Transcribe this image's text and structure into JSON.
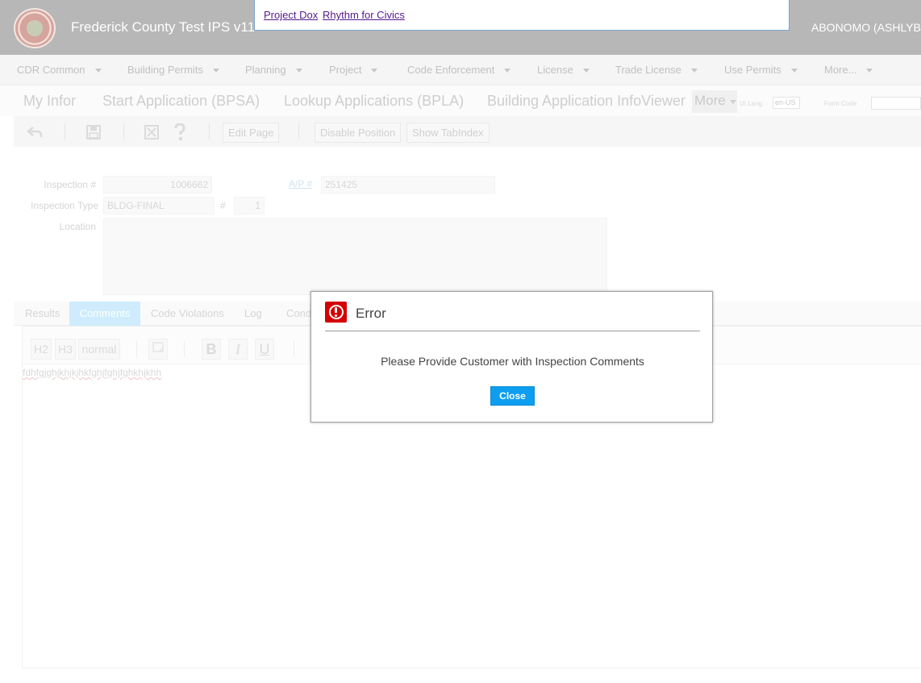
{
  "header": {
    "app_title": "Frederick County Test IPS v11",
    "user": "ABONOMO (ASHLYB"
  },
  "popup_links": {
    "project_dox": "Project Dox",
    "rhythm": "Rhythm for Civics"
  },
  "nav": {
    "items": [
      "CDR Common",
      "Building Permits",
      "Planning",
      "Project",
      "Code Enforcement",
      "License",
      "Trade License",
      "Use Permits",
      "More..."
    ]
  },
  "top_tabs": {
    "items": [
      "My Infor",
      "Start Application (BPSA)",
      "Lookup Applications (BPLA)",
      "Building Application InfoViewer"
    ],
    "more": "More",
    "ui_lang_label": "UI Lang",
    "ui_lang_value": "en-US",
    "form_code_label": "Form Code"
  },
  "toolbar": {
    "edit_page": "Edit Page",
    "disable_position": "Disable Position",
    "show_tabindex": "Show TabIndex"
  },
  "form": {
    "inspection_label": "Inspection #",
    "inspection_value": "1006662",
    "ap_label": "A/P #",
    "ap_value": "251425",
    "type_label": "Inspection Type",
    "type_value": "BLDG-FINAL",
    "hash_label": "#",
    "hash_value": "1",
    "location_label": "Location"
  },
  "sub_tabs": {
    "items": [
      "Results",
      "Comments",
      "Code Violations",
      "Log",
      "Cond"
    ],
    "active": "Comments"
  },
  "editor": {
    "h2": "H2",
    "h3": "H3",
    "normal": "normal",
    "bold": "B",
    "italic": "I",
    "underline": "U",
    "content": "fdhfgjghjkhjkjhkfghjfghjfghkhjkhh"
  },
  "modal": {
    "title": "Error",
    "message": "Please Provide Customer with Inspection Comments",
    "close_label": "Close"
  },
  "colors": {
    "header_bg": "#7c7c7c",
    "error_red": "#d40000",
    "close_blue": "#0d9ef0",
    "active_tab": "#a7dcfb"
  }
}
